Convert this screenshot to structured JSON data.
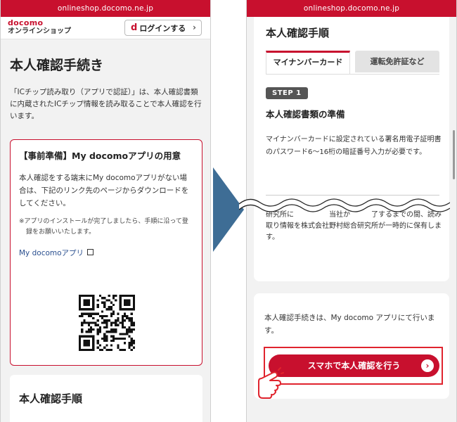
{
  "left_phone": {
    "url": "onlineshop.docomo.ne.jp",
    "logo": {
      "brand": "docomo",
      "sub": "オンラインショップ"
    },
    "login_button": {
      "icon_letter": "d",
      "label": "ログインする"
    },
    "page_title": "本人確認手続き",
    "intro": "「ICチップ読み取り（アプリで認証）」は、本人確認書類に内蔵されたICチップ情報を読み取ることで本人確認を行います。",
    "prep_card": {
      "title": "【事前準備】My docomoアプリの用意",
      "body": "本人確認をする端末にMy docomoアプリがない場合は、下記のリンク先のページからダウンロードをしてください。",
      "note": "※アプリのインストールが完了しましたら、手順に沿って登録をお願いいたします。",
      "app_link": "My docomoアプリ"
    },
    "steps_card": {
      "title": "本人確認手順"
    }
  },
  "right_phone": {
    "url": "onlineshop.docomo.ne.jp",
    "heading": "本人確認手順",
    "tabs": [
      {
        "label": "マイナンバーカード",
        "active": true
      },
      {
        "label": "運転免許証など",
        "active": false
      }
    ],
    "step_badge": "STEP 1",
    "step_title": "本人確認書類の準備",
    "step_text": "マイナンバーカードに設定されている署名用電子証明書のパスワード6〜16桁の暗証番号入力が必要です。",
    "cut_text": "研究所に　　　　　当社か　　　了するまでの間、読み取り情報を株式会社野村総合研究所が一時的に保有します。",
    "bottom_text": "本人確認手続きは、My docomo アプリにて行います。",
    "cta_label": "スマホで本人確認を行う"
  },
  "colors": {
    "brand_red": "#c8102e",
    "arrow_blue": "#3e6d95",
    "highlight": "#e0242e"
  },
  "icons": [
    "external-link-icon",
    "qr-code",
    "chevron-right-icon",
    "pointing-hand-icon"
  ]
}
